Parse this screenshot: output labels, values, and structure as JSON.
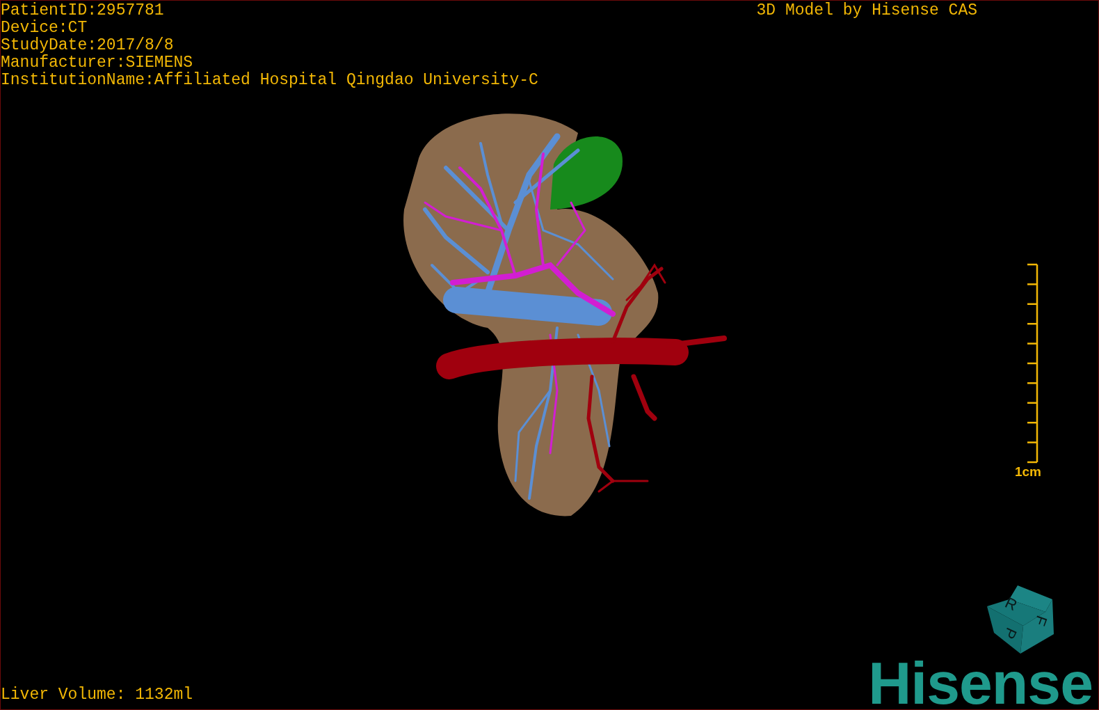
{
  "overlay": {
    "patient_info": [
      "PatientID:2957781",
      "Device:CT",
      "StudyDate:2017/8/8",
      "Manufacturer:SIEMENS",
      "InstitutionName:Affiliated Hospital Qingdao University-C"
    ],
    "title": "3D Model by Hisense CAS"
  },
  "viewport": {
    "scale_bar": {
      "label": "1cm"
    },
    "orientation_cube": {
      "faces": [
        "R",
        "F",
        "P"
      ]
    }
  },
  "footer": {
    "liver_volume": "Liver Volume: 1132ml",
    "logo": "Hisense"
  }
}
